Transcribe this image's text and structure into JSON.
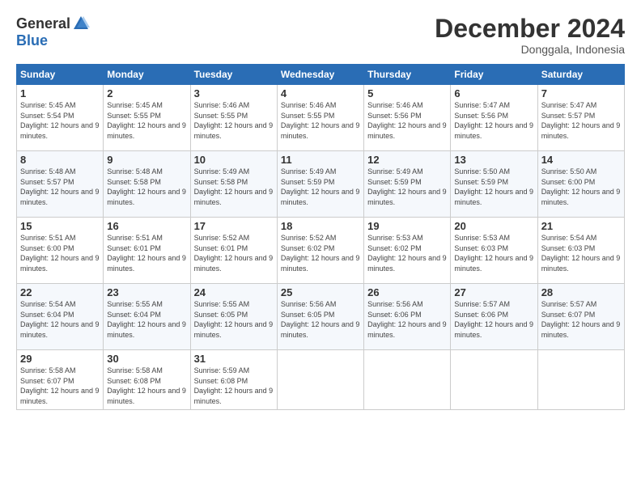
{
  "logo": {
    "general": "General",
    "blue": "Blue"
  },
  "title": "December 2024",
  "subtitle": "Donggala, Indonesia",
  "days_header": [
    "Sunday",
    "Monday",
    "Tuesday",
    "Wednesday",
    "Thursday",
    "Friday",
    "Saturday"
  ],
  "weeks": [
    [
      {
        "day": "1",
        "sunrise": "5:45 AM",
        "sunset": "5:54 PM",
        "daylight": "12 hours and 9 minutes."
      },
      {
        "day": "2",
        "sunrise": "5:45 AM",
        "sunset": "5:55 PM",
        "daylight": "12 hours and 9 minutes."
      },
      {
        "day": "3",
        "sunrise": "5:46 AM",
        "sunset": "5:55 PM",
        "daylight": "12 hours and 9 minutes."
      },
      {
        "day": "4",
        "sunrise": "5:46 AM",
        "sunset": "5:55 PM",
        "daylight": "12 hours and 9 minutes."
      },
      {
        "day": "5",
        "sunrise": "5:46 AM",
        "sunset": "5:56 PM",
        "daylight": "12 hours and 9 minutes."
      },
      {
        "day": "6",
        "sunrise": "5:47 AM",
        "sunset": "5:56 PM",
        "daylight": "12 hours and 9 minutes."
      },
      {
        "day": "7",
        "sunrise": "5:47 AM",
        "sunset": "5:57 PM",
        "daylight": "12 hours and 9 minutes."
      }
    ],
    [
      {
        "day": "8",
        "sunrise": "5:48 AM",
        "sunset": "5:57 PM",
        "daylight": "12 hours and 9 minutes."
      },
      {
        "day": "9",
        "sunrise": "5:48 AM",
        "sunset": "5:58 PM",
        "daylight": "12 hours and 9 minutes."
      },
      {
        "day": "10",
        "sunrise": "5:49 AM",
        "sunset": "5:58 PM",
        "daylight": "12 hours and 9 minutes."
      },
      {
        "day": "11",
        "sunrise": "5:49 AM",
        "sunset": "5:59 PM",
        "daylight": "12 hours and 9 minutes."
      },
      {
        "day": "12",
        "sunrise": "5:49 AM",
        "sunset": "5:59 PM",
        "daylight": "12 hours and 9 minutes."
      },
      {
        "day": "13",
        "sunrise": "5:50 AM",
        "sunset": "5:59 PM",
        "daylight": "12 hours and 9 minutes."
      },
      {
        "day": "14",
        "sunrise": "5:50 AM",
        "sunset": "6:00 PM",
        "daylight": "12 hours and 9 minutes."
      }
    ],
    [
      {
        "day": "15",
        "sunrise": "5:51 AM",
        "sunset": "6:00 PM",
        "daylight": "12 hours and 9 minutes."
      },
      {
        "day": "16",
        "sunrise": "5:51 AM",
        "sunset": "6:01 PM",
        "daylight": "12 hours and 9 minutes."
      },
      {
        "day": "17",
        "sunrise": "5:52 AM",
        "sunset": "6:01 PM",
        "daylight": "12 hours and 9 minutes."
      },
      {
        "day": "18",
        "sunrise": "5:52 AM",
        "sunset": "6:02 PM",
        "daylight": "12 hours and 9 minutes."
      },
      {
        "day": "19",
        "sunrise": "5:53 AM",
        "sunset": "6:02 PM",
        "daylight": "12 hours and 9 minutes."
      },
      {
        "day": "20",
        "sunrise": "5:53 AM",
        "sunset": "6:03 PM",
        "daylight": "12 hours and 9 minutes."
      },
      {
        "day": "21",
        "sunrise": "5:54 AM",
        "sunset": "6:03 PM",
        "daylight": "12 hours and 9 minutes."
      }
    ],
    [
      {
        "day": "22",
        "sunrise": "5:54 AM",
        "sunset": "6:04 PM",
        "daylight": "12 hours and 9 minutes."
      },
      {
        "day": "23",
        "sunrise": "5:55 AM",
        "sunset": "6:04 PM",
        "daylight": "12 hours and 9 minutes."
      },
      {
        "day": "24",
        "sunrise": "5:55 AM",
        "sunset": "6:05 PM",
        "daylight": "12 hours and 9 minutes."
      },
      {
        "day": "25",
        "sunrise": "5:56 AM",
        "sunset": "6:05 PM",
        "daylight": "12 hours and 9 minutes."
      },
      {
        "day": "26",
        "sunrise": "5:56 AM",
        "sunset": "6:06 PM",
        "daylight": "12 hours and 9 minutes."
      },
      {
        "day": "27",
        "sunrise": "5:57 AM",
        "sunset": "6:06 PM",
        "daylight": "12 hours and 9 minutes."
      },
      {
        "day": "28",
        "sunrise": "5:57 AM",
        "sunset": "6:07 PM",
        "daylight": "12 hours and 9 minutes."
      }
    ],
    [
      {
        "day": "29",
        "sunrise": "5:58 AM",
        "sunset": "6:07 PM",
        "daylight": "12 hours and 9 minutes."
      },
      {
        "day": "30",
        "sunrise": "5:58 AM",
        "sunset": "6:08 PM",
        "daylight": "12 hours and 9 minutes."
      },
      {
        "day": "31",
        "sunrise": "5:59 AM",
        "sunset": "6:08 PM",
        "daylight": "12 hours and 9 minutes."
      },
      null,
      null,
      null,
      null
    ]
  ]
}
